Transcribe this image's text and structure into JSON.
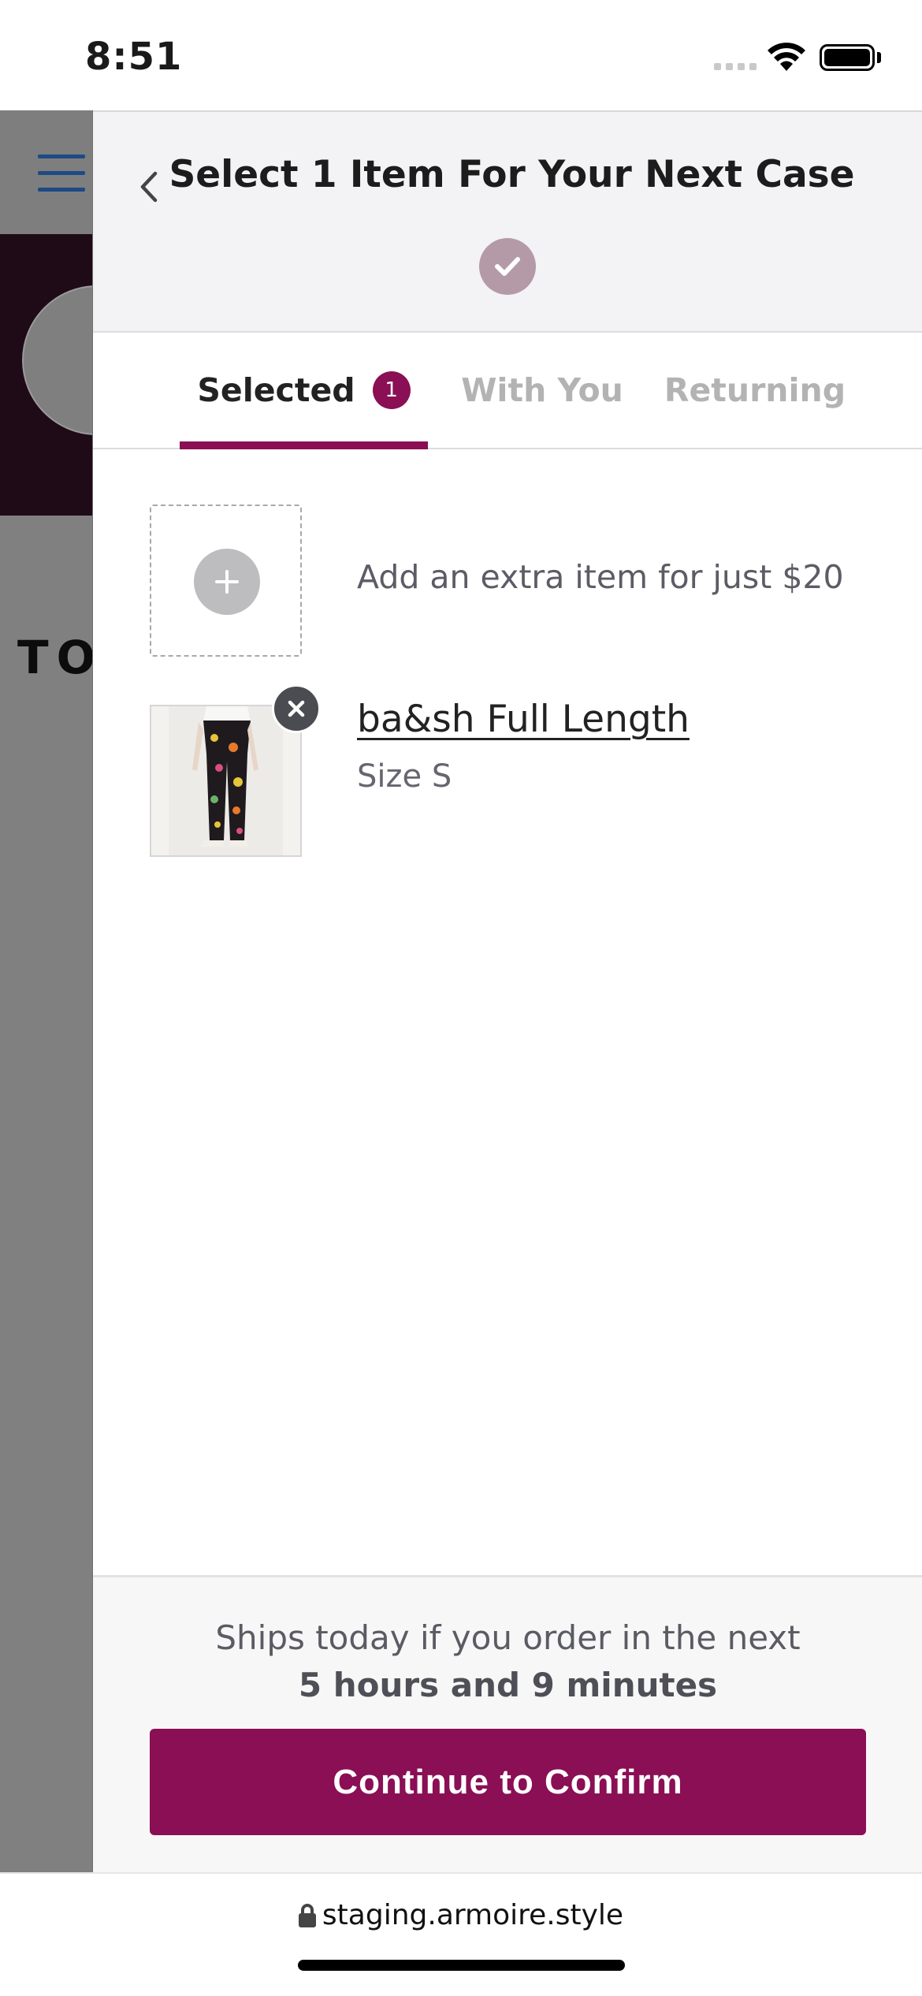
{
  "status_bar": {
    "time": "8:51",
    "icons": [
      "cellular-signal-icon",
      "wifi-icon",
      "battery-icon"
    ]
  },
  "background_page": {
    "menu_icon": "hamburger-menu-icon",
    "heading_fragment": "TO",
    "colors": {
      "banner": "#1f0a17",
      "menu": "#1e4a85"
    }
  },
  "drawer": {
    "back_icon": "chevron-left-icon",
    "title": "Select 1 Item For Your Next Case",
    "step_icon": "check-icon",
    "tabs": [
      {
        "label": "Selected",
        "badge": "1",
        "active": true
      },
      {
        "label": "With You",
        "active": false
      },
      {
        "label": "Returning",
        "active": false
      }
    ],
    "add_item": {
      "icon": "plus-icon",
      "label": "Add an extra item for just $20"
    },
    "items": [
      {
        "name": "ba&sh Full Length",
        "size": "Size S",
        "remove_icon": "close-icon"
      }
    ],
    "footer": {
      "ship_text": "Ships today if you order in the next",
      "ship_time": "5 hours and 9 minutes",
      "cta_label": "Continue to Confirm"
    },
    "colors": {
      "accent": "#8a0f55",
      "step_check": "#b49aa7"
    }
  },
  "browser": {
    "lock_icon": "lock-icon",
    "url": "staging.armoire.style"
  }
}
